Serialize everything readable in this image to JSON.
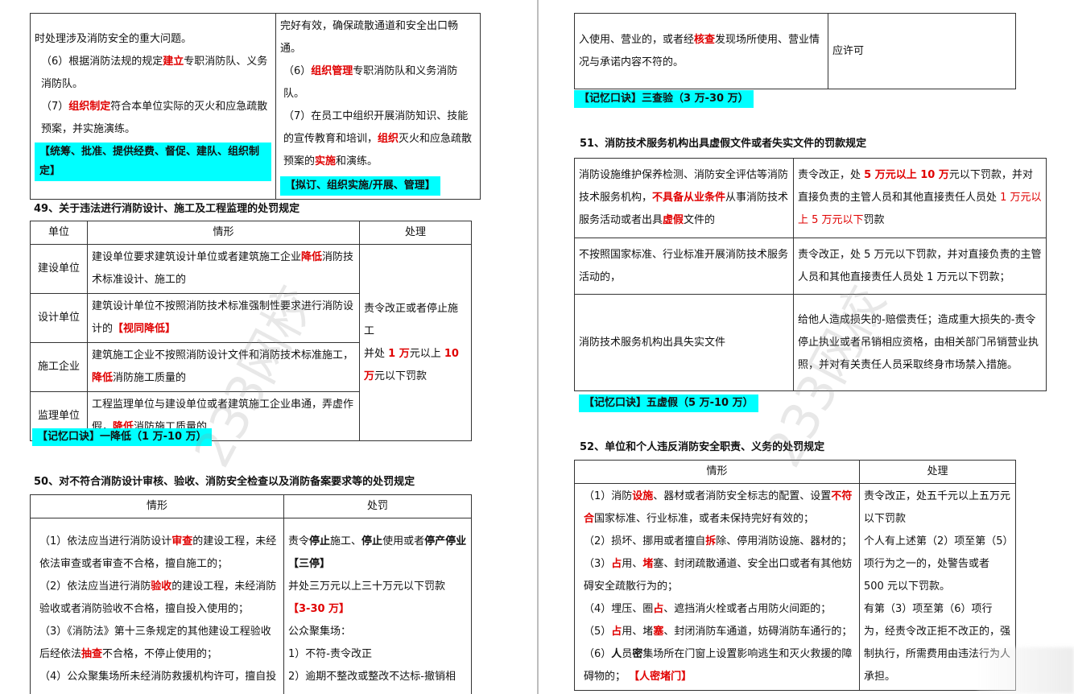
{
  "left": {
    "top_table": {
      "col1": [
        "时处理涉及消防安全的重大问题。",
        [
          "（6）根据消防法规的规定",
          "建立",
          "专职消防队、义务消防队。"
        ],
        [
          "（7）",
          "组织制定",
          "符合本单位实际的灭火和应急疏散预案，并实施演练。"
        ],
        "【统筹、批准、提供经费、督促、建队、组织制定】"
      ],
      "col2": [
        "完好有效，确保疏散通道和安全出口畅通。",
        [
          "（6）",
          "组织管理",
          "专职消防队和义务消防队。"
        ],
        [
          "（7）在员工中组织开展消防知识、技能的宣传教育和培训，",
          "组织",
          "灭火和应急疏散预案的",
          "实施",
          "和演练。"
        ],
        "【拟订、组织实施/开展、管理】"
      ]
    },
    "sec49": {
      "title": "49、关于违法进行消防设计、施工及工程监理的处罚规定",
      "headers": [
        "单位",
        "情形",
        "处理"
      ],
      "rows": [
        {
          "unit": "建设单位",
          "text": [
            "建设单位要求建筑设计单位或者建筑施工企业",
            "降低",
            "消防技术标准设计、施工的"
          ]
        },
        {
          "unit": "设计单位",
          "text": [
            "建筑设计单位不按照消防技术标准强制性要求进行消防设计的",
            "【视同降低】",
            ""
          ]
        },
        {
          "unit": "施工企业",
          "text": [
            "建筑施工企业不按照消防设计文件和消防技术标准施工，",
            "降低",
            "消防施工质量的"
          ]
        },
        {
          "unit": "监理单位",
          "text": [
            "工程监理单位与建设单位或者建筑施工企业串通，弄虚作假，",
            "降低",
            "消防施工质量的"
          ]
        }
      ],
      "penalty": [
        "责令改正或者停止施工",
        "并处",
        "1 万",
        "元以上",
        "10 万",
        "元以下罚款"
      ],
      "memo": "【记忆口诀】一降低（1 万-10 万）"
    },
    "sec50": {
      "title": "50、对不符合消防设计审核、验收、消防安全检查以及消防备案要求等的处罚规定",
      "headers": [
        "情形",
        "处罚"
      ],
      "items": [
        [
          "（1）依法应当进行消防设计",
          "审查",
          "的建设工程，未经依法审查或者审查不合格，擅自施工的；"
        ],
        [
          "（2）依法应当进行消防",
          "验收",
          "的建设工程，未经消防验收或者消防验收不合格，擅自投入使用的；"
        ],
        [
          "（3）《消防法》第十三条规定的其他建设工程验收后经依法",
          "抽查",
          "不合格，不停止使用的；"
        ],
        [
          "（4）公众聚集场所未经消防救援机构许可，擅自投",
          "",
          ""
        ]
      ],
      "penalty": {
        "line1": [
          "责令",
          "停止",
          "施工、",
          "停止",
          "使用或者",
          "停产停业【三停】"
        ],
        "line2": "并处三万元以上三十万元以下罚款",
        "line3": "【3-30 万】",
        "line4": "公众聚集场：",
        "line5": "1）不符-责令改正",
        "line6": "2）逾期不整改或整改不达标-撤销相"
      }
    },
    "watermark": "233网校"
  },
  "right": {
    "top_table": {
      "left_pre": "入使用、营业的，或者经",
      "left_red": "核查",
      "left_post": "发现场所使用、营业情况与承诺内容不符的。",
      "right": "应许可"
    },
    "memo50": "【记忆口诀】三查验（3 万-30 万）",
    "sec51": {
      "title": "51、消防技术服务机构出具虚假文件或者失实文件的罚款规定",
      "rows": [
        {
          "case": [
            "消防设施维护保养检测、消防安全评估等消防技术服务机构，",
            "不具备从业条件",
            "从事消防技术服务活动或者出具",
            "虚假",
            "文件的"
          ],
          "penalty": [
            "责令改正，处 ",
            "5 万元以上 10 万",
            "元以下罚款，并对直接负责的主管人员和其他直接责任人员处 ",
            "1 万元以上 5 万元以下",
            "罚款"
          ]
        },
        {
          "case": [
            "不按照国家标准、行业标准开展消防技术服务活动的，"
          ],
          "penalty": [
            "责令改正，处 5 万元以下罚款，并对直接负责的主管人员和其他直接责任人员处 1 万元以下罚款；"
          ]
        },
        {
          "case": [
            "消防技术服务机构出具失实文件"
          ],
          "penalty": [
            "给他人造成损失的-赔偿责任；造成重大损失的-责令停止执业或者吊销相应资格，由相关部门吊销营业执照，并对有关责任人员采取终身市场禁入措施。"
          ]
        }
      ],
      "memo": "【记忆口诀】五虚假（5 万-10 万）"
    },
    "sec52": {
      "title": "52、单位和个人违反消防安全职责、义务的处罚规定",
      "headers": [
        "情形",
        "处理"
      ],
      "items": [
        [
          "（1）消防",
          "设施",
          "、器材或者消防安全标志的配置、设置",
          "不符合",
          "国家标准、行业标准，或者未保持完好有效的；"
        ],
        [
          "（2）损坏、挪用或者擅自",
          "拆",
          "除、停用消防设施、器材的；"
        ],
        [
          "（3）",
          "占",
          "用、",
          "堵",
          "塞、封闭疏散通道、安全出口或者有其他妨碍安全疏散行为的；"
        ],
        [
          "（4）埋压、圈",
          "占",
          "、遮挡消火栓或者占用防火间距的；"
        ],
        [
          "（5）",
          "占",
          "用、堵",
          "塞",
          "、封闭消防车通道，妨碍消防车通行的；"
        ],
        [
          "（6）",
          "人",
          "员",
          "密",
          "集场所在门窗上设置影响逃生和灭火救援的障碍物的；",
          "【人密堵门】"
        ]
      ],
      "penalty": [
        "责令改正，处五千元以上五万元以下罚款",
        "个人有上述第（2）项至第（5）项行为之一的，处警告或者 500 元以下罚款。",
        "有第（3）项至第（6）项行为，经责令改正拒不改正的，强制执行，所需费用由违法行为人承担。"
      ]
    },
    "watermark": "233网校"
  }
}
